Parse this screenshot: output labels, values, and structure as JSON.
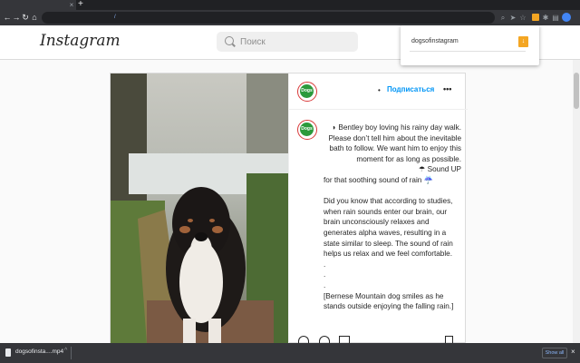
{
  "browser": {
    "new_tab_icon": "+",
    "tab_close_icon": "×",
    "nav": {
      "back": "←",
      "forward": "→",
      "reload": "↻",
      "home": "⌂"
    },
    "omnibox_text": "/",
    "toolbar_icons": [
      "search-icon",
      "send-icon",
      "star-icon",
      "puzzle-icon",
      "media-icon"
    ],
    "accent": "#f4a623"
  },
  "instagram": {
    "logo": "Instagram",
    "search_placeholder": "Поиск"
  },
  "extension_popup": {
    "text": "dogsofinstagram"
  },
  "post": {
    "account_avatar_label": "Dogs",
    "follow_dot": "•",
    "follow_label": "Подписаться",
    "more_label": "•••",
    "caption": [
      {
        "text": "◗ Bentley boy loving his rainy day walk. Please don’t tell him about the inevitable bath to follow. We want him to enjoy this moment for as long as possible.",
        "align": "left"
      },
      {
        "text": "☂ Sound UP",
        "align": "right"
      },
      {
        "text": "for that soothing sound of rain ☔",
        "align": "left"
      },
      {
        "text": "",
        "align": "gap"
      },
      {
        "text": "Did you know that according to studies, when rain sounds enter our brain, our brain unconsciously relaxes and generates alpha waves, resulting in a state similar to sleep. The sound of rain helps us relax and we feel comfortable.",
        "align": "left"
      },
      {
        "text": ".",
        "align": "left"
      },
      {
        "text": ".",
        "align": "left"
      },
      {
        "text": ".",
        "align": "left"
      },
      {
        "text": "[Bernese Mountain dog smiles as he stands outside enjoying the falling rain.]",
        "align": "left"
      }
    ]
  },
  "download": {
    "filename": "dogsofinsta....mp4",
    "caret": "^",
    "show_all": "Show all",
    "close": "×"
  }
}
